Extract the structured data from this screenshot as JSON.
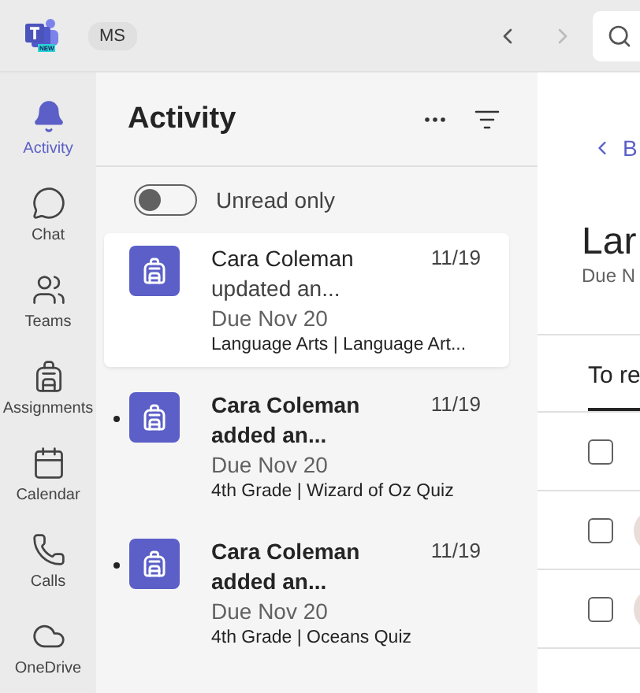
{
  "app_bar": {
    "logo_badge": "NEW",
    "account": "MS"
  },
  "rail": [
    {
      "label": "Activity",
      "selected": true
    },
    {
      "label": "Chat",
      "selected": false
    },
    {
      "label": "Teams",
      "selected": false
    },
    {
      "label": "Assignments",
      "selected": false
    },
    {
      "label": "Calendar",
      "selected": false
    },
    {
      "label": "Calls",
      "selected": false
    },
    {
      "label": "OneDrive",
      "selected": false
    }
  ],
  "activity": {
    "title": "Activity",
    "unread_toggle": {
      "label": "Unread only",
      "on": false
    },
    "items": [
      {
        "name": "Cara Coleman",
        "action": "updated an...",
        "date": "11/19",
        "due": "Due Nov 20",
        "context": "Language Arts | Language Art...",
        "unread": false,
        "selected": true
      },
      {
        "name": "Cara Coleman",
        "action": "added an...",
        "date": "11/19",
        "due": "Due Nov 20",
        "context": "4th Grade | Wizard of Oz Quiz",
        "unread": true,
        "selected": false
      },
      {
        "name": "Cara Coleman",
        "action": "added an...",
        "date": "11/19",
        "due": "Due Nov 20",
        "context": "4th Grade | Oceans Quiz",
        "unread": true,
        "selected": false
      }
    ]
  },
  "detail": {
    "back_label": "B",
    "title": "Lar",
    "subtitle": "Due N",
    "tab": "To re",
    "rows": [
      {
        "checked": false,
        "avatar": false
      },
      {
        "checked": false,
        "avatar": true
      },
      {
        "checked": false,
        "avatar": true
      }
    ]
  }
}
